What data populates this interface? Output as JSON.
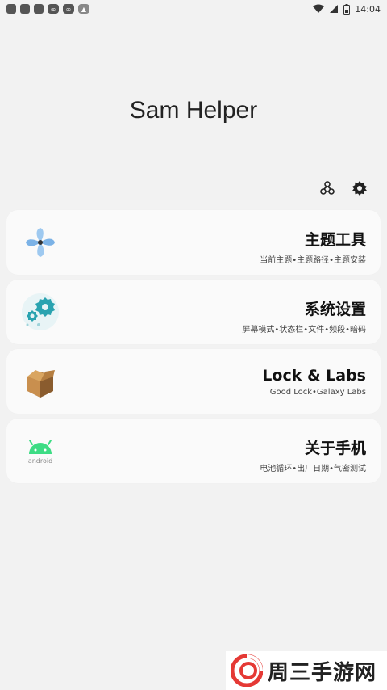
{
  "status_bar": {
    "time": "14:04"
  },
  "header": {
    "title": "Sam Helper"
  },
  "toolbar": {
    "icons": [
      "labs-icon",
      "gear-icon"
    ]
  },
  "cards": [
    {
      "title": "主题工具",
      "subtitle": "当前主题•主题路径•主题安装",
      "icon": "fan-icon"
    },
    {
      "title": "系统设置",
      "subtitle": "屏幕模式•状态栏•文件•频段•暗码",
      "icon": "gears-icon"
    },
    {
      "title": "Lock & Labs",
      "subtitle": "Good Lock•Galaxy Labs",
      "icon": "box-icon"
    },
    {
      "title": "关于手机",
      "subtitle": "电池循环•出厂日期•气密测试",
      "icon": "android-icon"
    }
  ],
  "watermark": {
    "text": "周三手游网"
  },
  "colors": {
    "background": "#f2f2f2",
    "card": "#fafafa",
    "android_green": "#3ddc84",
    "gear_teal": "#2aa3b0",
    "box_brown": "#a8743d"
  }
}
